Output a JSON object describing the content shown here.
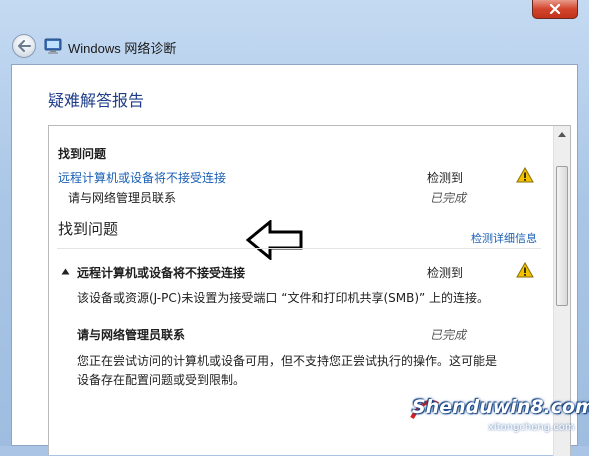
{
  "window": {
    "title": "Windows 网络诊断"
  },
  "page": {
    "heading": "疑难解答报告"
  },
  "summary": {
    "section_title": "找到问题",
    "rows": [
      {
        "label": "远程计算机或设备将不接受连接",
        "status": "检测到",
        "icon": "warning-icon"
      },
      {
        "label": "请与网络管理员联系",
        "status": "已完成"
      }
    ]
  },
  "details": {
    "section_title": "找到问题",
    "detail_link": "检测详细信息",
    "issue_title": "远程计算机或设备将不接受连接",
    "issue_status": "检测到",
    "issue_description": "该设备或资源(J-PC)未设置为接受端口 “文件和打印机共享(SMB)” 上的连接。",
    "followup_title": "请与网络管理员联系",
    "followup_status": "已完成",
    "followup_description_line1": "您正在尝试访问的计算机或设备可用，但不支持您正尝试执行的操作。这可能是",
    "followup_description_line2": "设备存在配置问题或受到限制。"
  },
  "watermark": {
    "main": "Shenduwin8.com",
    "sub": "xitongcheng.com"
  },
  "colors": {
    "heading": "#1f3d8a",
    "link": "#1a5fb4",
    "warning": "#f2c200"
  }
}
